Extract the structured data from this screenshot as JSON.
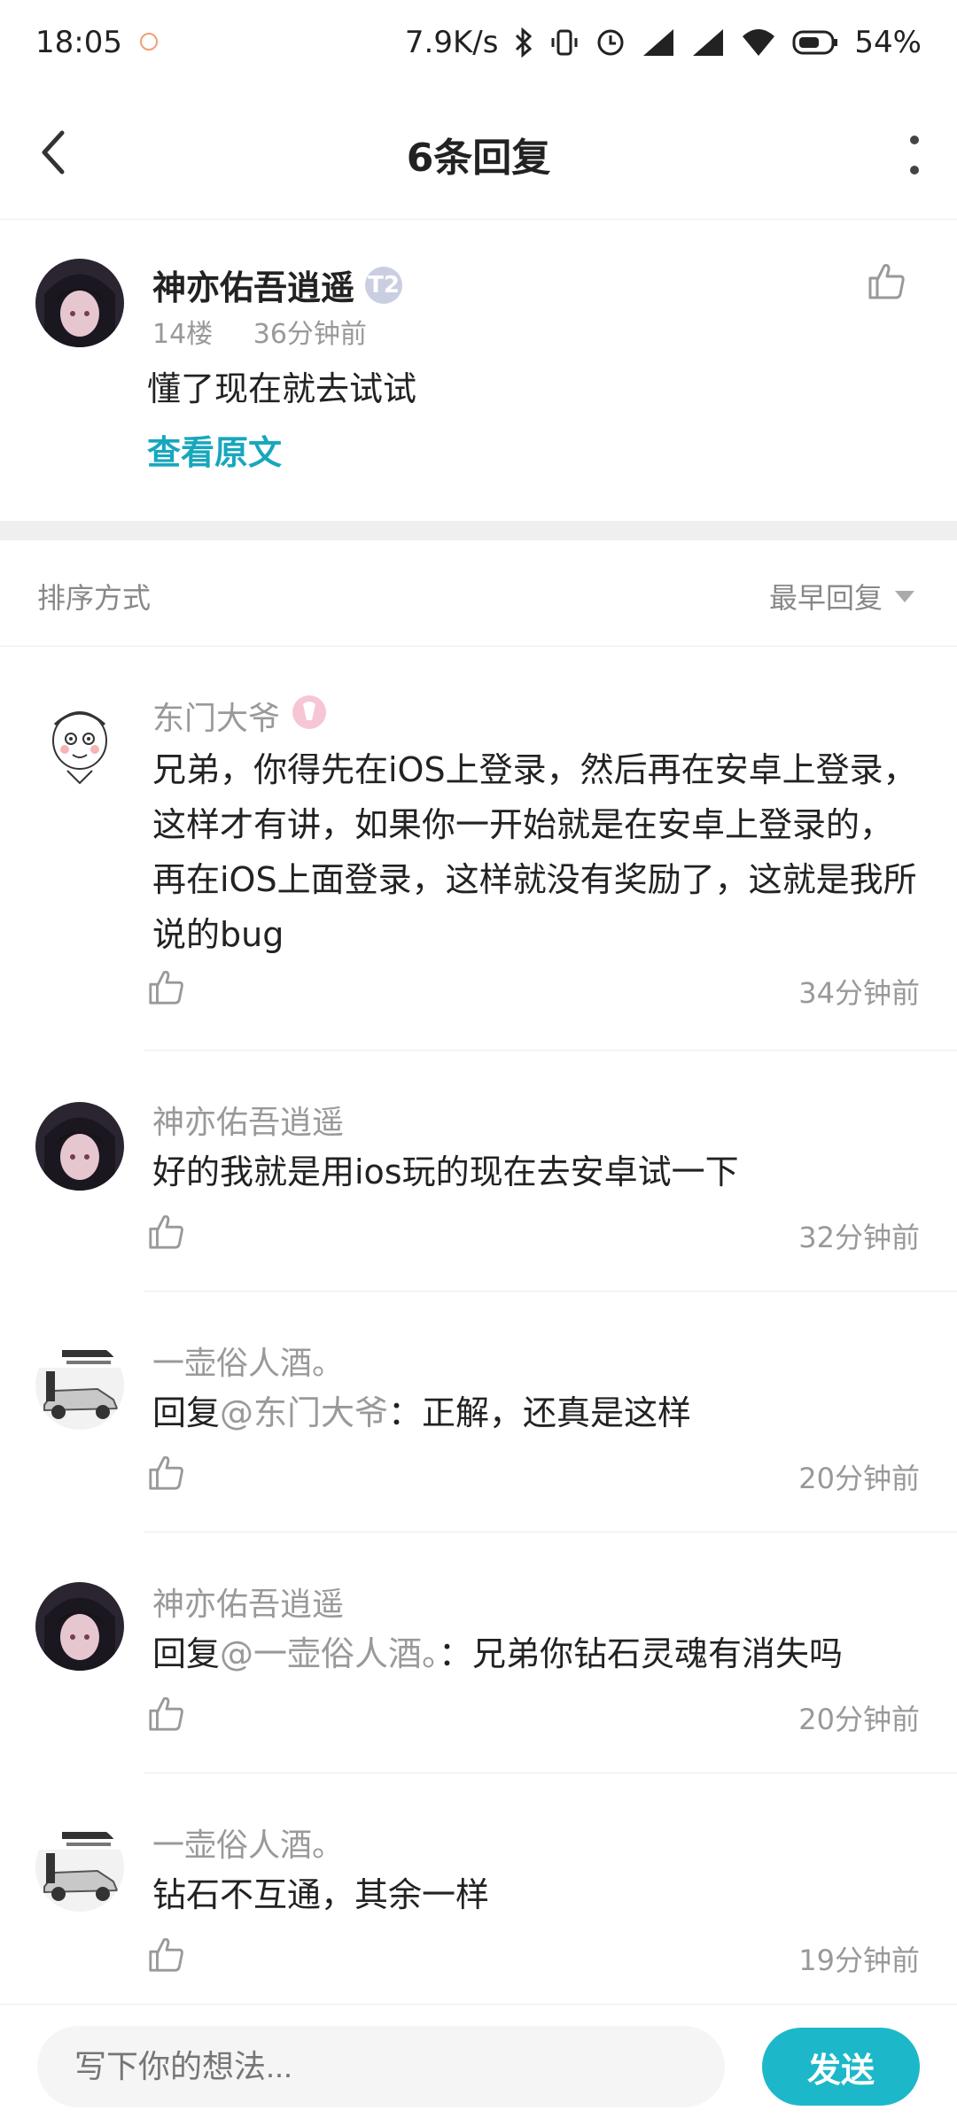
{
  "status": {
    "time": "18:05",
    "net_speed": "7.9K/s",
    "battery": "54%"
  },
  "header": {
    "title": "6条回复"
  },
  "parent_comment": {
    "author": "神亦佑吾逍遥",
    "badge": "T2",
    "floor": "14楼",
    "time": "36分钟前",
    "text": "懂了现在就去试试",
    "view_original": "查看原文"
  },
  "sort": {
    "label": "排序方式",
    "selected": "最早回复"
  },
  "replies": [
    {
      "author": "东门大爷",
      "text": "兄弟，你得先在iOS上登录，然后再在安卓上登录，这样才有讲，如果你一开始就是在安卓上登录的，再在iOS上面登录，这样就没有奖励了，这就是我所说的bug",
      "time": "34分钟前"
    },
    {
      "author": "神亦佑吾逍遥",
      "text": "好的我就是用ios玩的现在去安卓试一下",
      "time": "32分钟前"
    },
    {
      "author": "一壶俗人酒。",
      "prefix": "回复",
      "mention": "@东门大爷",
      "text": "：正解，还真是这样",
      "time": "20分钟前"
    },
    {
      "author": "神亦佑吾逍遥",
      "prefix": "回复",
      "mention": "@一壶俗人酒。",
      "text": "：兄弟你钻石灵魂有消失吗",
      "time": "20分钟前"
    },
    {
      "author": "一壶俗人酒。",
      "text": "钻石不互通，其余一样",
      "time": "19分钟前"
    }
  ],
  "composer": {
    "placeholder": "写下你的想法...",
    "send_label": "发送"
  },
  "colors": {
    "accent": "#1cb8c9",
    "link": "#18a7bd",
    "muted": "#999999"
  }
}
